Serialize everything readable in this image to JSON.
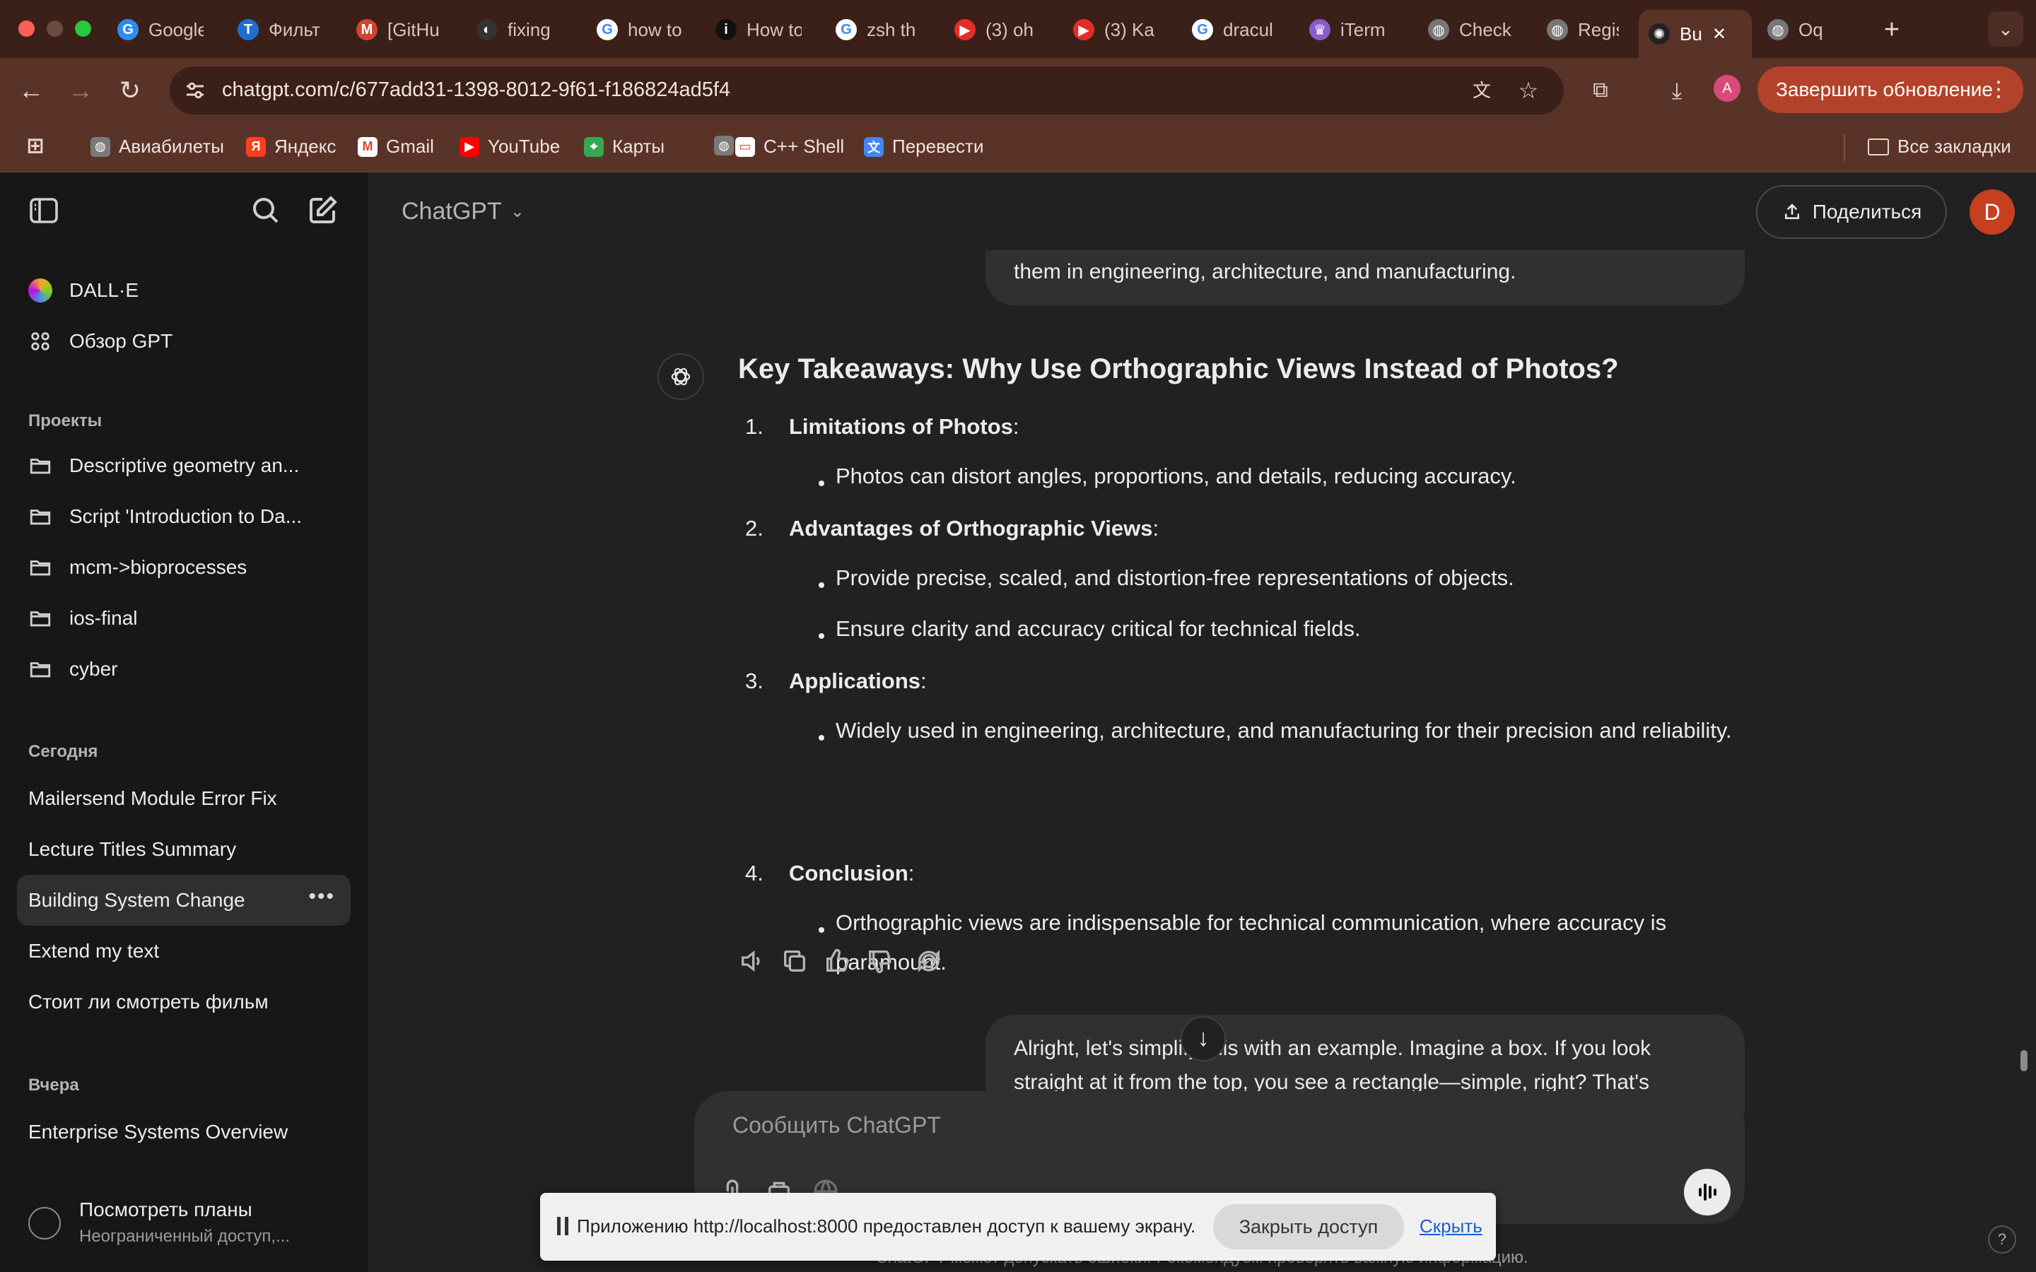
{
  "browser": {
    "tabs": [
      {
        "title": "Google",
        "fav": "G",
        "color": "#2d8cf0"
      },
      {
        "title": "Фильт",
        "fav": "T",
        "color": "#1c6fd1"
      },
      {
        "title": "[GitHu",
        "fav": "M",
        "color": "#d24330"
      },
      {
        "title": "fixing",
        "fav": "◐",
        "color": "#333333"
      },
      {
        "title": "how to",
        "fav": "G",
        "color": "#ffffff"
      },
      {
        "title": "How to",
        "fav": "i",
        "color": "#111111"
      },
      {
        "title": "zsh th",
        "fav": "G",
        "color": "#ffffff"
      },
      {
        "title": "(3) oh",
        "fav": "▶",
        "color": "#e52d27"
      },
      {
        "title": "(3) Ka",
        "fav": "▶",
        "color": "#e52d27"
      },
      {
        "title": "dracul",
        "fav": "G",
        "color": "#ffffff"
      },
      {
        "title": "iTerm",
        "fav": "♛",
        "color": "#8a5cc9"
      },
      {
        "title": "Check",
        "fav": "◍",
        "color": "#777777"
      },
      {
        "title": "Regist",
        "fav": "◍",
        "color": "#777777"
      },
      {
        "title": "Bu",
        "fav": "✺",
        "color": "#222222"
      },
      {
        "title": "Oq",
        "fav": "◍",
        "color": "#777777"
      }
    ],
    "url": "chatgpt.com/c/677add31-1398-8012-9f61-f186824ad5f4",
    "update_label": "Завершить обновление",
    "profile_letter": "A",
    "bookmarks": [
      {
        "label": "",
        "icon": "apps-grid-icon"
      },
      {
        "label": "Авиабилеты",
        "icon": "globe-icon"
      },
      {
        "label": "Яндекс",
        "icon": "yandex-icon"
      },
      {
        "label": "Gmail",
        "icon": "gmail-icon"
      },
      {
        "label": "YouTube",
        "icon": "youtube-icon"
      },
      {
        "label": "Карты",
        "icon": "maps-icon"
      },
      {
        "label": "",
        "icon": "globe-icon"
      },
      {
        "label": "C++ Shell",
        "icon": "shell-icon"
      },
      {
        "label": "Перевести",
        "icon": "translate-icon"
      }
    ],
    "all_bookmarks": "Все закладки"
  },
  "sidebar": {
    "gpts": [
      {
        "label": "DALL·E",
        "icon": "dalle-icon"
      },
      {
        "label": "Обзор GPT",
        "icon": "grid-icon"
      }
    ],
    "projects_heading": "Проекты",
    "projects": [
      "Descriptive geometry an...",
      "Script 'Introduction to Da...",
      "mcm->bioprocesses",
      "ios-final",
      "cyber"
    ],
    "today_heading": "Сегодня",
    "today": [
      "Mailersend Module Error Fix",
      "Lecture Titles Summary",
      "Building System Change",
      "Extend my text",
      "Стоит ли смотреть фильм"
    ],
    "yesterday_heading": "Вчера",
    "yesterday": [
      "Enterprise Systems Overview"
    ],
    "plans_title": "Посмотреть планы",
    "plans_sub": "Неограниченный доступ,..."
  },
  "header": {
    "model": "ChatGPT",
    "share": "Поделиться",
    "avatar_letter": "D"
  },
  "conversation": {
    "prev_user_tail": "them in engineering, architecture, and manufacturing.",
    "heading": "Key Takeaways: Why Use Orthographic Views Instead of Photos?",
    "items": [
      {
        "num": "1.",
        "title": "Limitations of Photos",
        "bullets": [
          "Photos can distort angles, proportions, and details, reducing accuracy."
        ]
      },
      {
        "num": "2.",
        "title": "Advantages of Orthographic Views",
        "bullets": [
          "Provide precise, scaled, and distortion-free representations of objects.",
          "Ensure clarity and accuracy critical for technical fields."
        ]
      },
      {
        "num": "3.",
        "title": "Applications",
        "bullets": [
          "Widely used in engineering, architecture, and manufacturing for their precision and reliability."
        ]
      },
      {
        "num": "4.",
        "title": "Conclusion",
        "bullets": [
          "Orthographic views are indispensable for technical communication, where accuracy is paramount."
        ]
      }
    ],
    "next_user": "Alright, let's simplify this with an example. Imagine a box. If you look straight at it from the top, you see a rectangle—simple, right? That's"
  },
  "composer": {
    "placeholder": "Сообщить ChatGPT",
    "disclaimer": "ChatGPT может допускать ошибки. Рекомендуем проверять важную информацию."
  },
  "screen_share": {
    "message": "Приложению http://localhost:8000 предоставлен доступ к вашему экрану.",
    "stop": "Закрыть доступ",
    "hide": "Скрыть"
  }
}
